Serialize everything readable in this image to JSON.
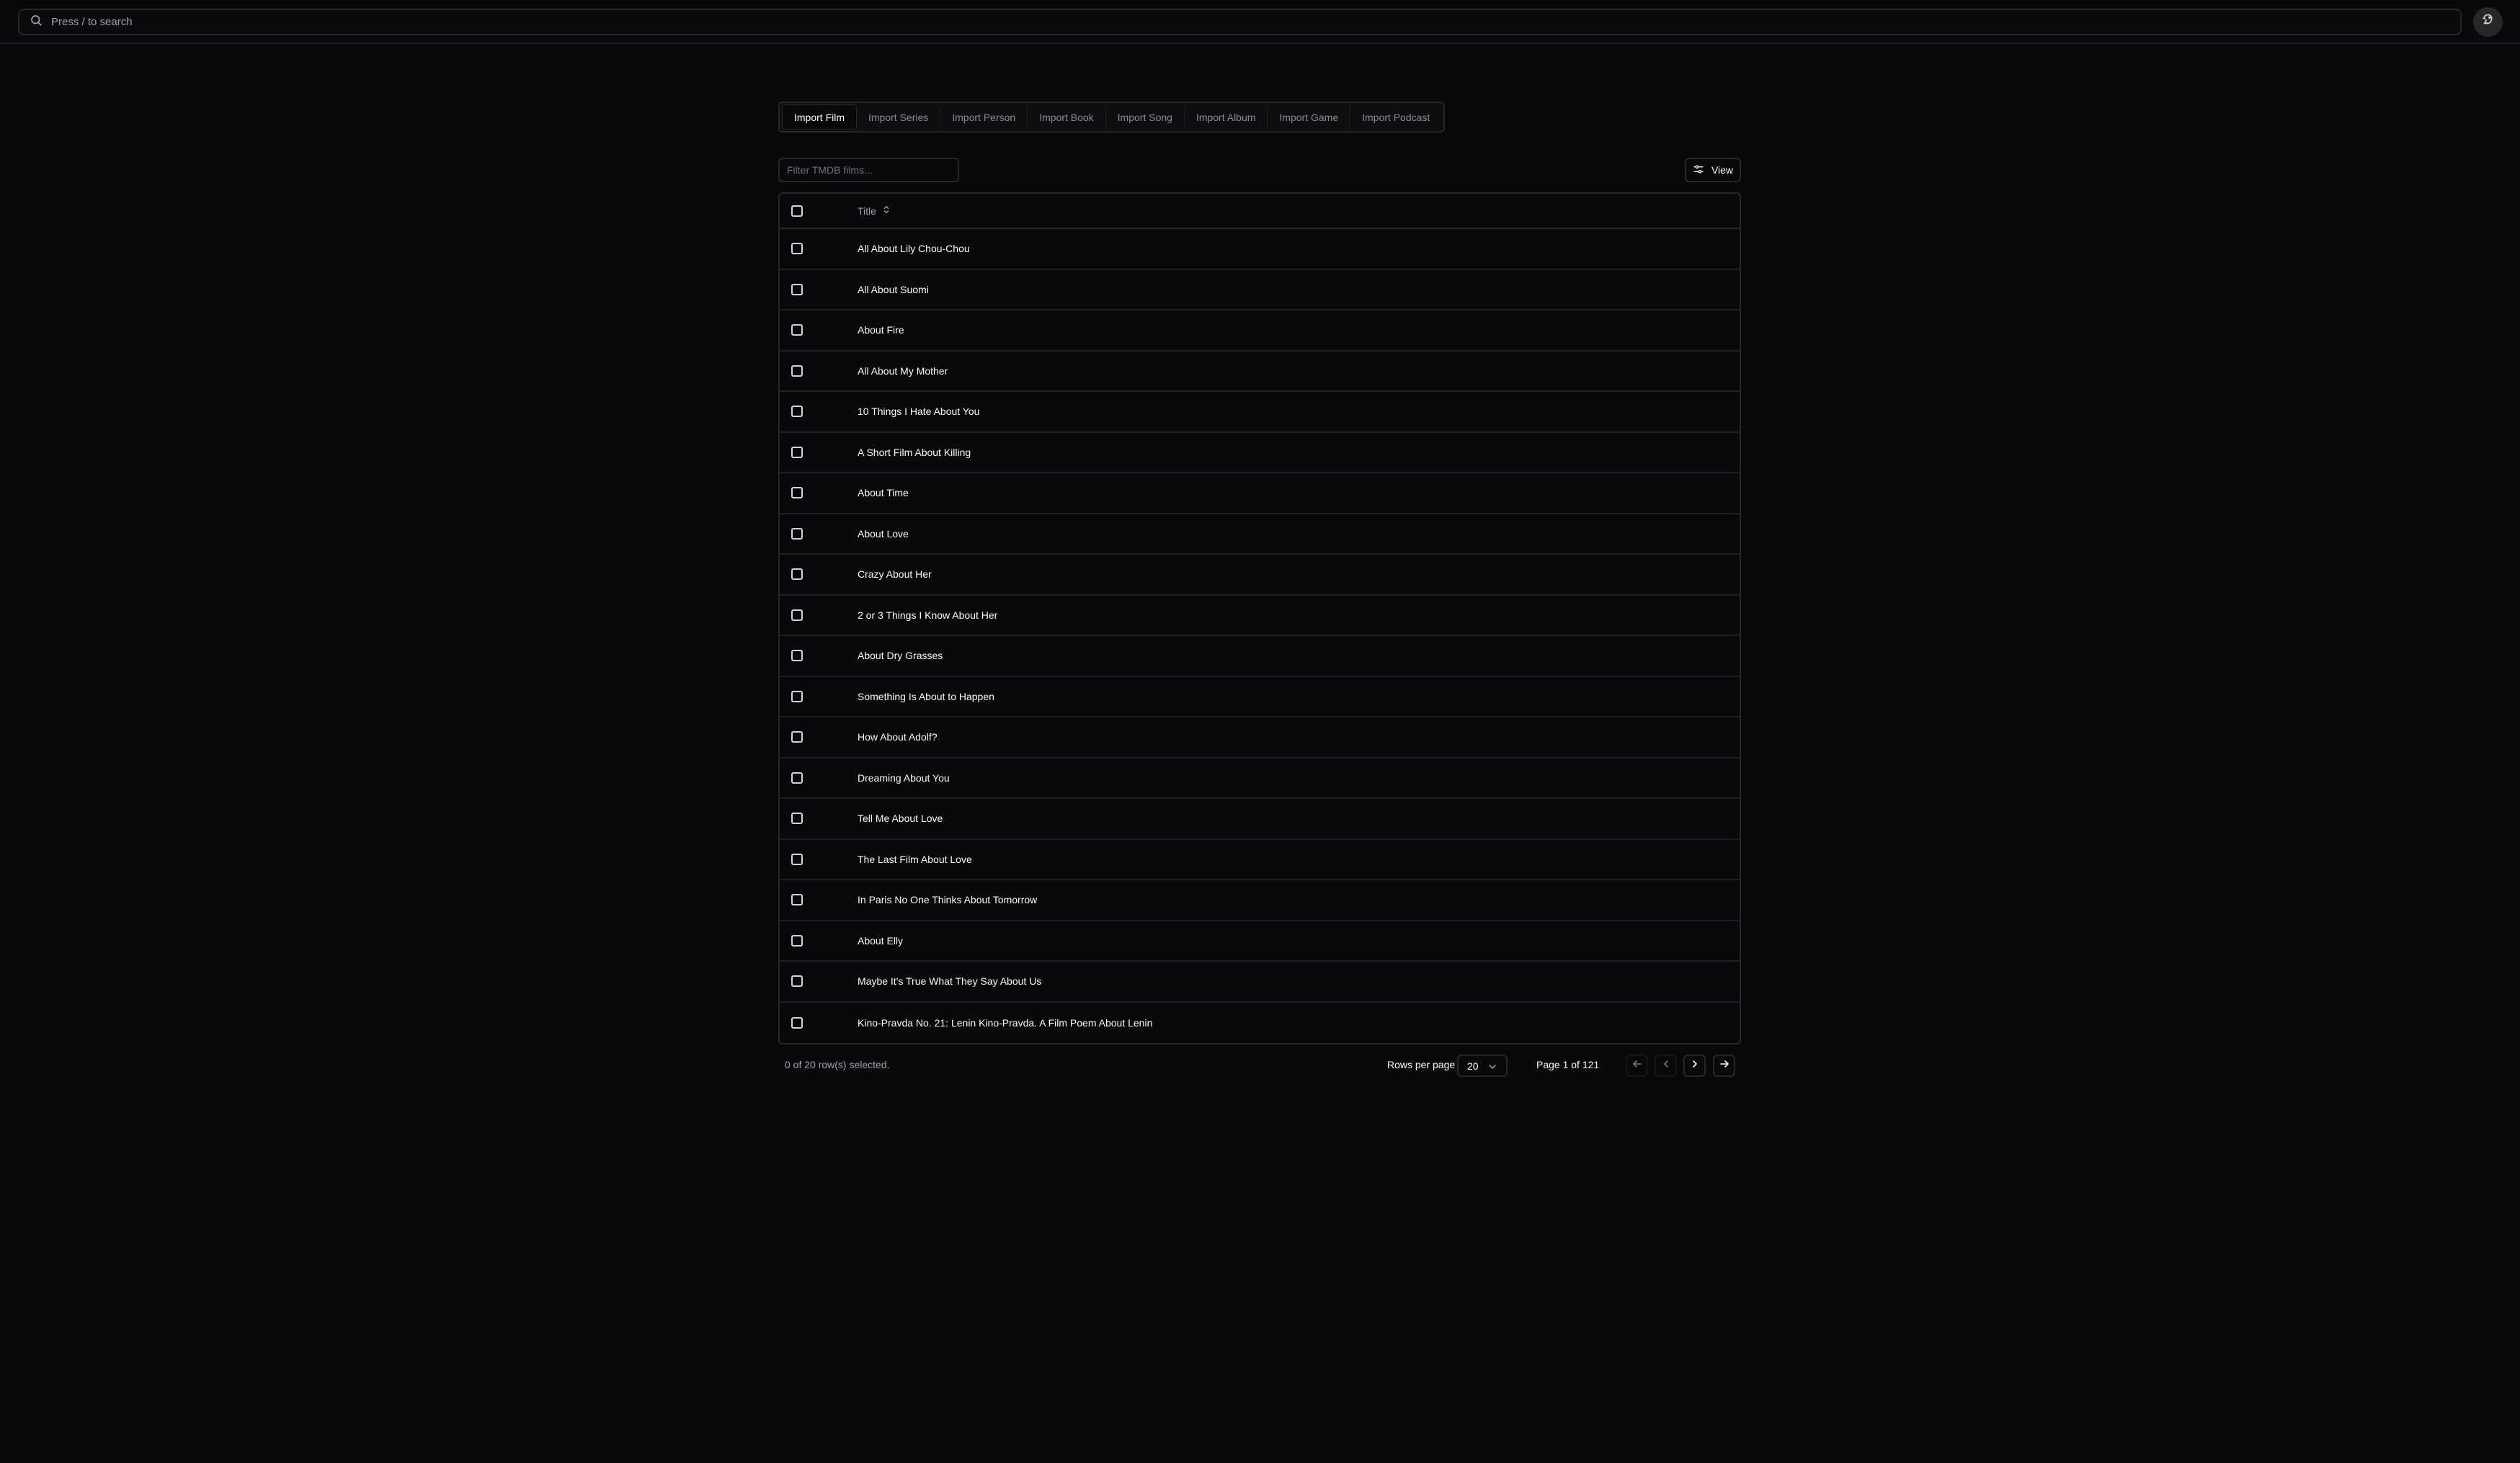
{
  "search": {
    "placeholder": "Press / to search",
    "icon": "search-icon"
  },
  "user_menu": {
    "icon": "avatar-icon"
  },
  "tabs": [
    {
      "label": "Import Film",
      "active": true
    },
    {
      "label": "Import Series",
      "active": false
    },
    {
      "label": "Import Person",
      "active": false
    },
    {
      "label": "Import Book",
      "active": false
    },
    {
      "label": "Import Song",
      "active": false
    },
    {
      "label": "Import Album",
      "active": false
    },
    {
      "label": "Import Game",
      "active": false
    },
    {
      "label": "Import Podcast",
      "active": false
    }
  ],
  "filter": {
    "placeholder": "Filter TMDB films..."
  },
  "view_button": {
    "label": "View",
    "icon": "sliders-icon"
  },
  "table": {
    "header": {
      "title": "Title",
      "sort_icon": "sort-icon"
    },
    "rows": [
      {
        "title": "All About Lily Chou-Chou"
      },
      {
        "title": "All About Suomi"
      },
      {
        "title": "About Fire"
      },
      {
        "title": "All About My Mother"
      },
      {
        "title": "10 Things I Hate About You"
      },
      {
        "title": "A Short Film About Killing"
      },
      {
        "title": "About Time"
      },
      {
        "title": "About Love"
      },
      {
        "title": "Crazy About Her"
      },
      {
        "title": "2 or 3 Things I Know About Her"
      },
      {
        "title": "About Dry Grasses"
      },
      {
        "title": "Something Is About to Happen"
      },
      {
        "title": "How About Adolf?"
      },
      {
        "title": "Dreaming About You"
      },
      {
        "title": "Tell Me About Love"
      },
      {
        "title": "The Last Film About Love"
      },
      {
        "title": "In Paris No One Thinks About Tomorrow"
      },
      {
        "title": "About Elly"
      },
      {
        "title": "Maybe It's True What They Say About Us"
      },
      {
        "title": "Kino-Pravda No. 21: Lenin Kino-Pravda. A Film Poem About Lenin"
      }
    ]
  },
  "footer": {
    "selected_text": "0 of 20 row(s) selected.",
    "rows_per_page_label": "Rows per page",
    "rows_per_page_value": "20",
    "page_info": "Page 1 of 121"
  },
  "colors": {
    "background": "#09090b",
    "border": "#27272a",
    "text": "#fafafa",
    "muted": "#a1a1aa"
  }
}
